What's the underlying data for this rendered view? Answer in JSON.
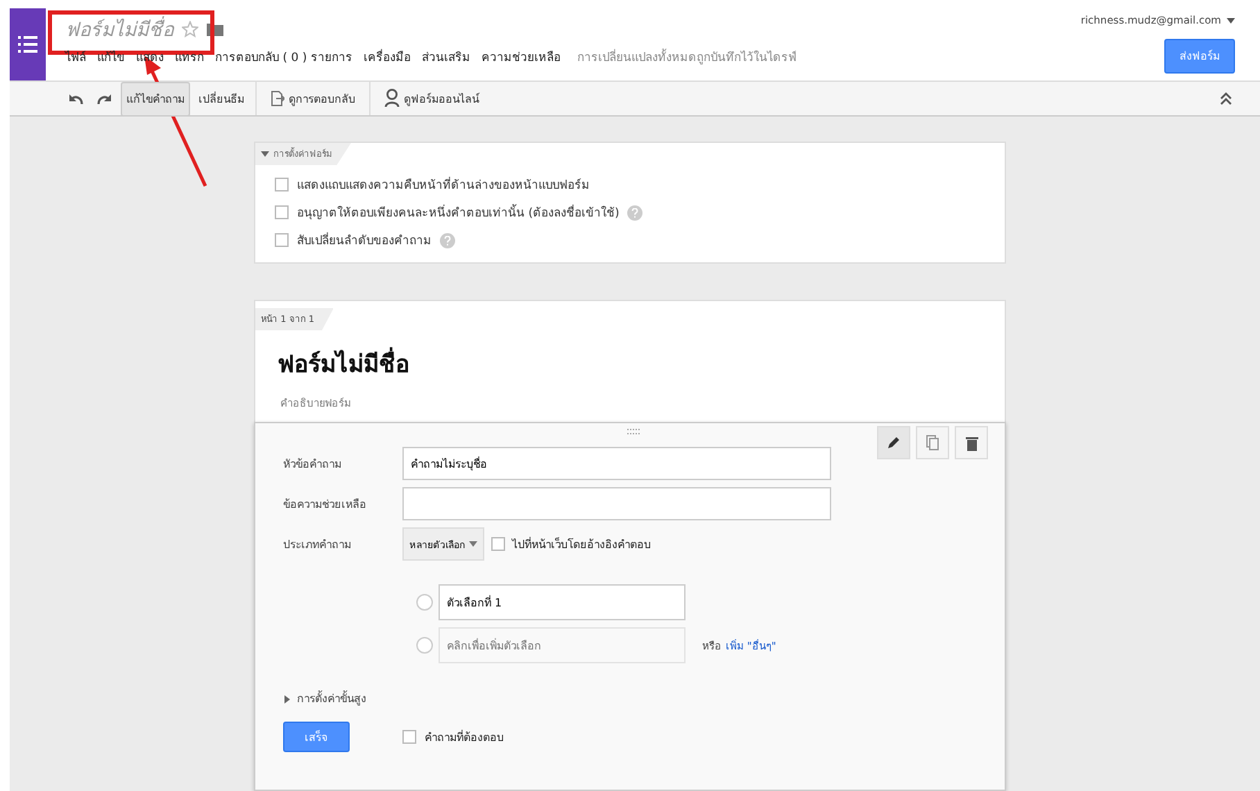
{
  "app_bar": {
    "title": "ฟอร์มไม่มีชื่อ",
    "starred": false,
    "account": "richness.mudz@gmail.com",
    "send_button": "ส่งฟอร์ม"
  },
  "menu": [
    "ไฟล์",
    "แก้ไข",
    "แสดง",
    "แทรก",
    "การตอบกลับ ( 0 ) รายการ",
    "เครื่องมือ",
    "ส่วนเสริม",
    "ความช่วยเหลือ"
  ],
  "save_status": "การเปลี่ยนแปลงทั้งหมดถูกบันทึกไว้ในไดรฟ์",
  "toolbar": {
    "tabs": [
      {
        "label": "แก้ไขคำถาม",
        "selected": true
      },
      {
        "label": "เปลี่ยนธีม",
        "selected": false
      }
    ],
    "actions": [
      {
        "label": "ดูการตอบกลับ",
        "kind": "responses"
      },
      {
        "label": "ดูฟอร์มออนไลน์",
        "kind": "live"
      }
    ]
  },
  "form_settings": {
    "title": "การตั้งค่าฟอร์ม",
    "expanded": true,
    "options": [
      {
        "label": "แสดงแถบแสดงความคืบหน้าที่ด้านล่างของหน้าแบบฟอร์ม",
        "checked": false,
        "help": false
      },
      {
        "label": "อนุญาตให้ตอบเพียงคนละหนึ่งคำตอบเท่านั้น (ต้องลงชื่อเข้าใช้)",
        "checked": false,
        "help": true
      },
      {
        "label": "สับเปลี่ยนลำดับของคำถาม",
        "checked": false,
        "help": true
      }
    ]
  },
  "page": {
    "indicator": "หน้า 1 จาก 1",
    "title": "ฟอร์มไม่มีชื่อ",
    "placeholder": "คำอธิบายฟอร์ม"
  },
  "question": {
    "title_label": "หัวข้อคำถาม",
    "title_value": "คำถามไม่ระบุชื่อ",
    "help_label": "ข้อความช่วยเหลือ",
    "type_label": "ประเภทคำถาม",
    "type_value": "หลายตัวเลือก",
    "go_to_page": {
      "label": "ไปที่หน้าเว็บโดยอ้างอิงคำตอบ",
      "checked": false
    },
    "options": [
      {
        "kind": "choice",
        "value": "ตัวเลือกที่ 1",
        "selected": false
      },
      {
        "kind": "add",
        "placeholder": "คลิกเพื่อเพิ่มตัวเลือก",
        "prefix": "หรือ",
        "link": "เพิ่ม \"อื่นๆ\"",
        "selected": false
      }
    ],
    "advanced": {
      "label": "การตั้งค่าขั้นสูง",
      "expanded": false
    },
    "done_button": "เสร็จ",
    "required": {
      "label": "คำถามที่ต้องตอบ",
      "checked": false
    }
  },
  "annotation": {
    "kind": "highlight-arrow"
  }
}
